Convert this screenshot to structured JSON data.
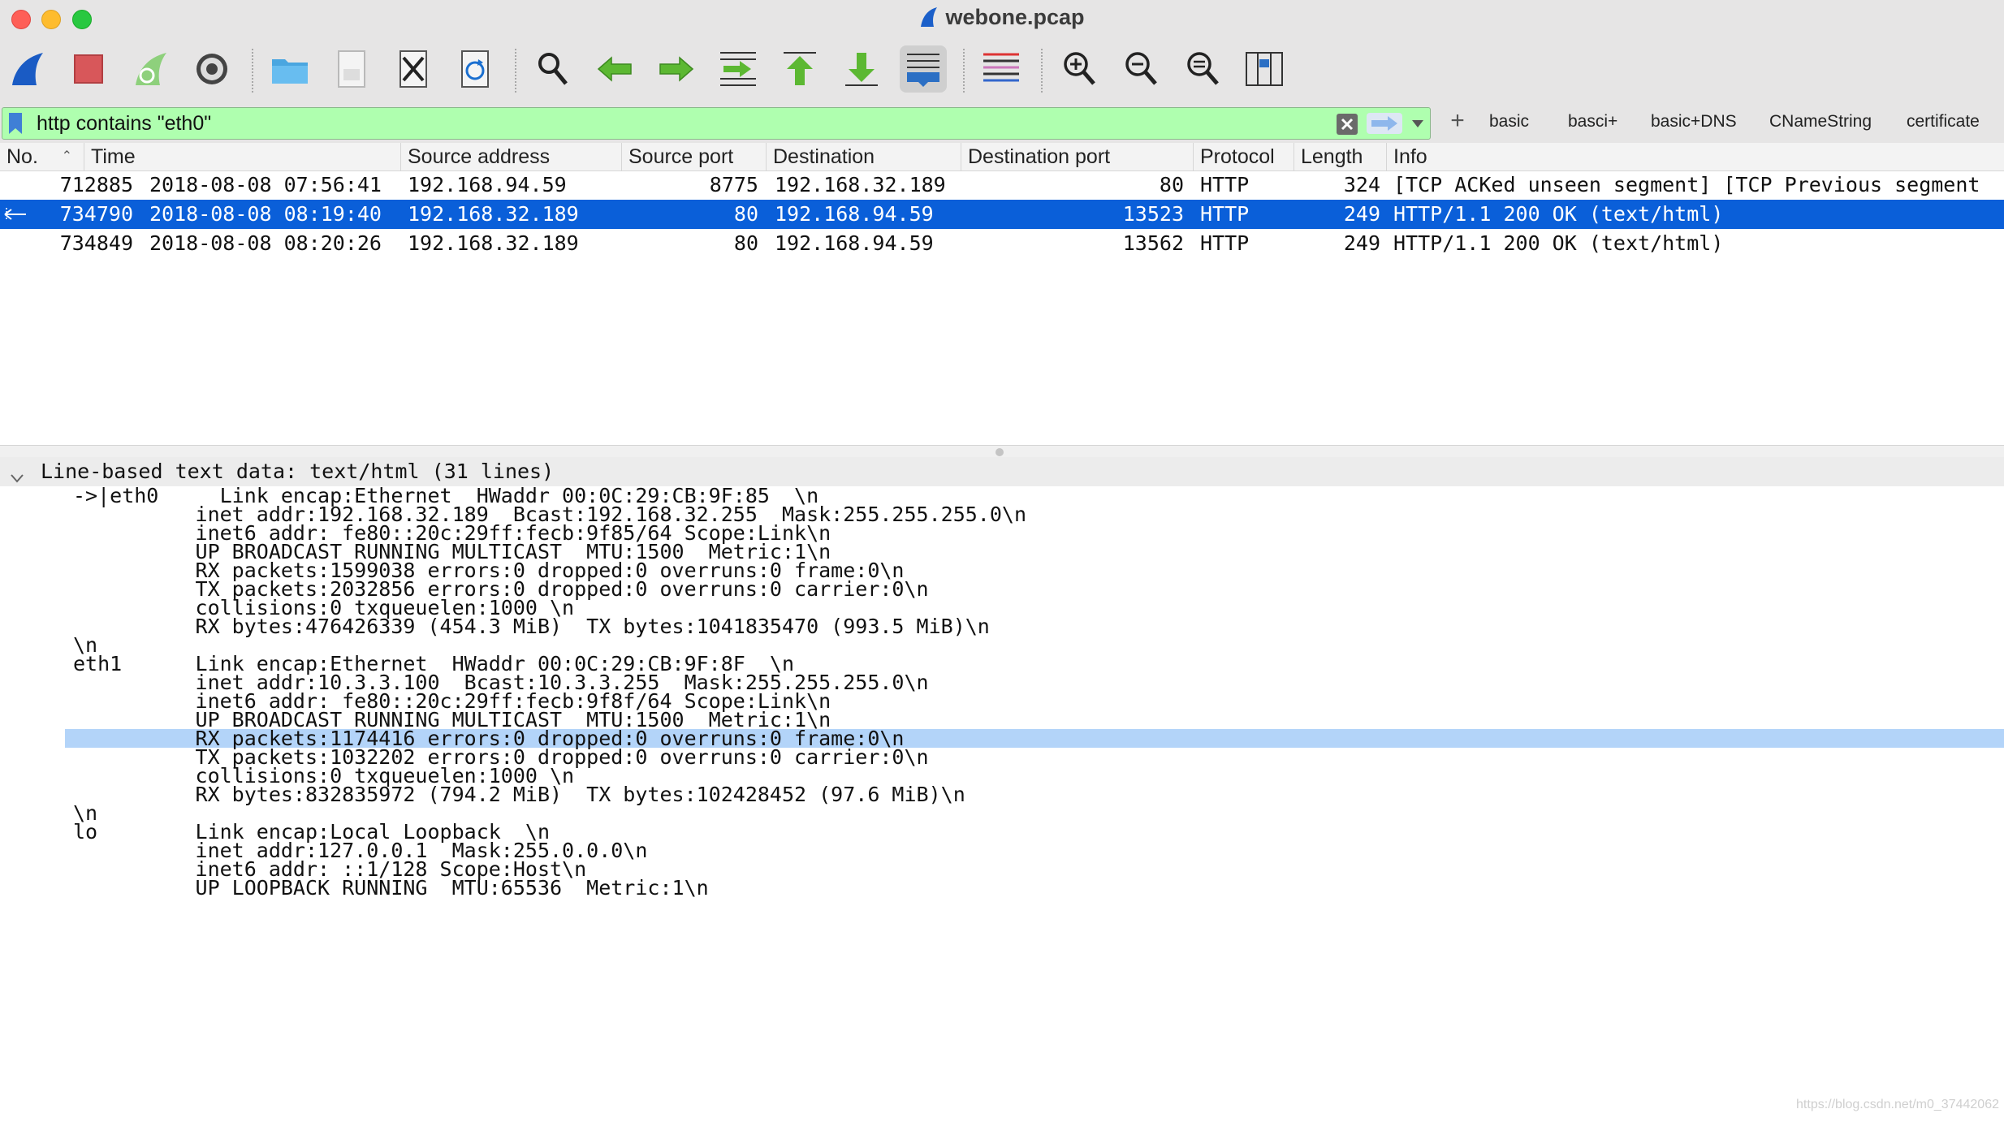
{
  "window": {
    "title": "webone.pcap"
  },
  "toolbar": {
    "buttons": [
      {
        "name": "start-capture-icon"
      },
      {
        "name": "stop-capture-icon"
      },
      {
        "name": "restart-capture-icon"
      },
      {
        "name": "capture-options-icon"
      },
      {
        "name": "open-file-icon"
      },
      {
        "name": "save-file-icon"
      },
      {
        "name": "close-file-icon"
      },
      {
        "name": "reload-file-icon"
      },
      {
        "name": "find-packet-icon"
      },
      {
        "name": "go-back-icon"
      },
      {
        "name": "go-forward-icon"
      },
      {
        "name": "go-to-packet-icon"
      },
      {
        "name": "go-first-packet-icon"
      },
      {
        "name": "go-last-packet-icon"
      },
      {
        "name": "auto-scroll-icon"
      },
      {
        "name": "colorize-icon"
      },
      {
        "name": "zoom-in-icon"
      },
      {
        "name": "zoom-out-icon"
      },
      {
        "name": "normal-size-icon"
      },
      {
        "name": "resize-columns-icon"
      }
    ]
  },
  "filter": {
    "value": "http contains \"eth0\"",
    "buttons": [
      "basic",
      "basci+",
      "basic+DNS",
      "CNameString",
      "certificate"
    ]
  },
  "packet_list": {
    "columns": [
      "No.",
      "Time",
      "Source address",
      "Source port",
      "Destination",
      "Destination port",
      "Protocol",
      "Length",
      "Info"
    ],
    "rows": [
      {
        "no": "712885",
        "time": "2018-08-08 07:56:41",
        "src": "192.168.94.59",
        "sport": "8775",
        "dst": "192.168.32.189",
        "dport": "80",
        "proto": "HTTP",
        "len": "324",
        "info": "[TCP ACKed unseen segment] [TCP Previous segment",
        "selected": false
      },
      {
        "no": "734790",
        "time": "2018-08-08 08:19:40",
        "src": "192.168.32.189",
        "sport": "80",
        "dst": "192.168.94.59",
        "dport": "13523",
        "proto": "HTTP",
        "len": "249",
        "info": "HTTP/1.1 200 OK  (text/html)",
        "selected": true
      },
      {
        "no": "734849",
        "time": "2018-08-08 08:20:26",
        "src": "192.168.32.189",
        "sport": "80",
        "dst": "192.168.94.59",
        "dport": "13562",
        "proto": "HTTP",
        "len": "249",
        "info": "HTTP/1.1 200 OK  (text/html)",
        "selected": false
      }
    ]
  },
  "details": {
    "title": "Line-based text data: text/html (31 lines)",
    "lines": [
      "->|eth0     Link encap:Ethernet  HWaddr 00:0C:29:CB:9F:85  \\n",
      "          inet addr:192.168.32.189  Bcast:192.168.32.255  Mask:255.255.255.0\\n",
      "          inet6 addr: fe80::20c:29ff:fecb:9f85/64 Scope:Link\\n",
      "          UP BROADCAST RUNNING MULTICAST  MTU:1500  Metric:1\\n",
      "          RX packets:1599038 errors:0 dropped:0 overruns:0 frame:0\\n",
      "          TX packets:2032856 errors:0 dropped:0 overruns:0 carrier:0\\n",
      "          collisions:0 txqueuelen:1000 \\n",
      "          RX bytes:476426339 (454.3 MiB)  TX bytes:1041835470 (993.5 MiB)\\n",
      "\\n",
      "eth1      Link encap:Ethernet  HWaddr 00:0C:29:CB:9F:8F  \\n",
      "          inet addr:10.3.3.100  Bcast:10.3.3.255  Mask:255.255.255.0\\n",
      "          inet6 addr: fe80::20c:29ff:fecb:9f8f/64 Scope:Link\\n",
      "          UP BROADCAST RUNNING MULTICAST  MTU:1500  Metric:1\\n",
      "          RX packets:1174416 errors:0 dropped:0 overruns:0 frame:0\\n",
      "          TX packets:1032202 errors:0 dropped:0 overruns:0 carrier:0\\n",
      "          collisions:0 txqueuelen:1000 \\n",
      "          RX bytes:832835972 (794.2 MiB)  TX bytes:102428452 (97.6 MiB)\\n",
      "\\n",
      "lo        Link encap:Local Loopback  \\n",
      "          inet addr:127.0.0.1  Mask:255.0.0.0\\n",
      "          inet6 addr: ::1/128 Scope:Host\\n",
      "          UP LOOPBACK RUNNING  MTU:65536  Metric:1\\n"
    ],
    "highlighted_line": 13
  },
  "watermark": "https://blog.csdn.net/m0_37442062",
  "colors": {
    "selection": "#0a5fd9",
    "filter_valid": "#afffaf",
    "detail_highlight": "#b3d4f9"
  }
}
